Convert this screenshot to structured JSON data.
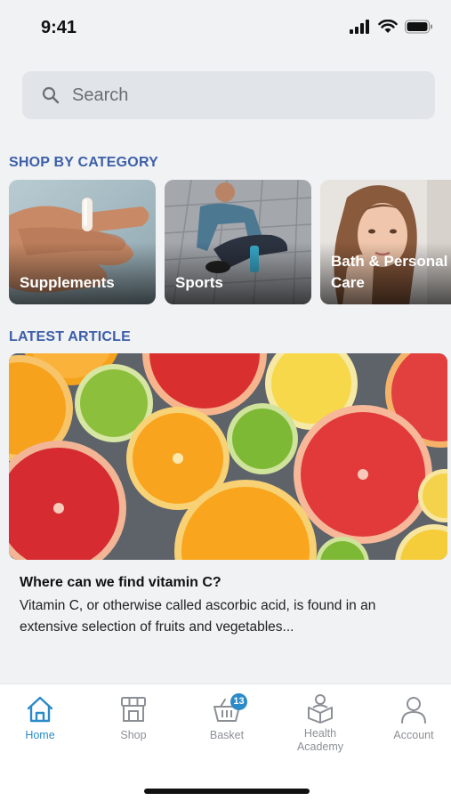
{
  "status_bar": {
    "time": "9:41"
  },
  "search": {
    "placeholder": "Search",
    "value": ""
  },
  "shop_by_category": {
    "title": "SHOP BY CATEGORY",
    "items": [
      {
        "label": "Supplements"
      },
      {
        "label": "Sports"
      },
      {
        "label": "Bath & Personal Care"
      }
    ]
  },
  "latest_article": {
    "title": "LATEST ARTICLE",
    "headline": "Where can we find vitamin C?",
    "excerpt": "Vitamin C, or otherwise called ascorbic acid, is found in an extensive selection of fruits and  vegetables..."
  },
  "bottom_nav": {
    "items": [
      {
        "label": "Home",
        "icon": "home-icon",
        "active": true
      },
      {
        "label": "Shop",
        "icon": "shop-icon",
        "active": false
      },
      {
        "label": "Basket",
        "icon": "basket-icon",
        "active": false,
        "badge": "13"
      },
      {
        "label": "Health Academy",
        "icon": "health-academy-icon",
        "active": false
      },
      {
        "label": "Account",
        "icon": "account-icon",
        "active": false
      }
    ]
  },
  "colors": {
    "accent": "#2a8bc8",
    "section_title": "#3d5fa8",
    "background": "#f0f2f4"
  }
}
